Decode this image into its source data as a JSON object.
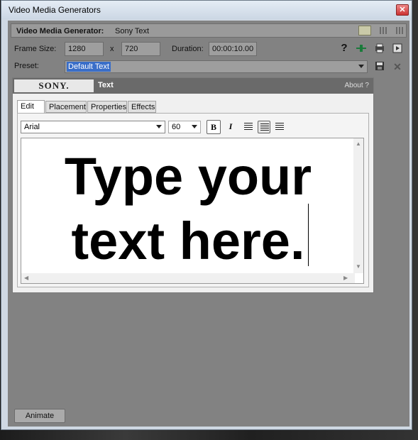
{
  "window": {
    "title": "Video Media Generators"
  },
  "header": {
    "label": "Video Media Generator:",
    "generator": "Sony Text"
  },
  "frame": {
    "label": "Frame Size:",
    "width": "1280",
    "x": "x",
    "height": "720"
  },
  "duration": {
    "label": "Duration:",
    "value": "00:00:10.00"
  },
  "preset": {
    "label": "Preset:",
    "value": "Default Text"
  },
  "icons": {
    "help": "?",
    "save": "save-icon",
    "close": "✕"
  },
  "plugin": {
    "brand": "SONY.",
    "name": "Text",
    "about": "About  ?"
  },
  "tabs": [
    "Edit",
    "Placement",
    "Properties",
    "Effects"
  ],
  "toolbar": {
    "font": "Arial",
    "size": "60",
    "bold": "B",
    "italic": "I"
  },
  "editor": {
    "line1": "Type your",
    "line2": "text here."
  },
  "animate_label": "Animate"
}
